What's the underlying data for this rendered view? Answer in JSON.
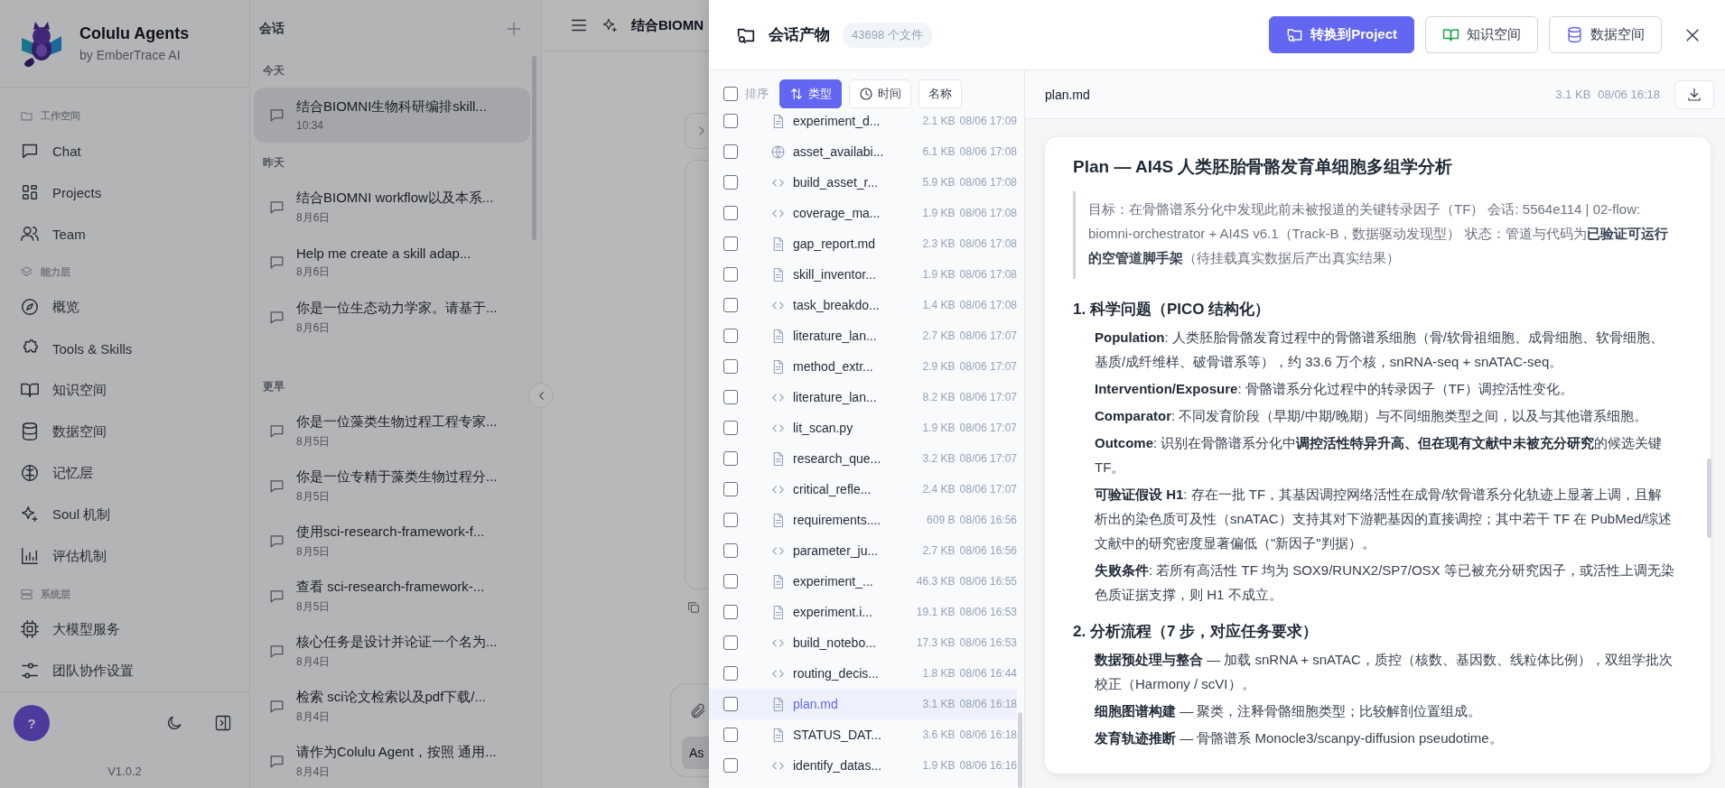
{
  "app": {
    "name": "Colulu Agents",
    "subtitle": "by EmberTrace AI",
    "help": "?",
    "version": "V1.0.2"
  },
  "sidebar": {
    "sections": [
      {
        "title": "工作空间",
        "kind": "folder",
        "items": [
          {
            "label": "Chat",
            "kind": "chat"
          },
          {
            "label": "Projects",
            "kind": "grid"
          },
          {
            "label": "Team",
            "kind": "team"
          }
        ]
      },
      {
        "title": "能力层",
        "kind": "layers",
        "items": [
          {
            "label": "概览",
            "kind": "compass"
          },
          {
            "label": "Tools & Skills",
            "kind": "puzzle"
          },
          {
            "label": "知识空间",
            "kind": "book"
          },
          {
            "label": "数据空间",
            "kind": "database"
          },
          {
            "label": "记忆层",
            "kind": "brain"
          },
          {
            "label": "Soul 机制",
            "kind": "sparkles"
          },
          {
            "label": "评估机制",
            "kind": "chart"
          }
        ]
      },
      {
        "title": "系统层",
        "kind": "server",
        "items": [
          {
            "label": "大模型服务",
            "kind": "cpu"
          },
          {
            "label": "团队协作设置",
            "kind": "sliders"
          }
        ]
      }
    ]
  },
  "conversations": {
    "title": "会话",
    "groups": [
      {
        "title": "今天",
        "items": [
          {
            "title": "结合BIOMNI生物科研编排skill...",
            "date": "10:34",
            "selected": true
          }
        ]
      },
      {
        "title": "昨天",
        "items": [
          {
            "title": "结合BIOMNI workflow以及本系...",
            "date": "8月6日",
            "selected": false
          },
          {
            "title": "Help me create a skill adap...",
            "date": "8月6日",
            "selected": false
          },
          {
            "title": "你是一位生态动力学家。请基于...",
            "date": "8月6日",
            "selected": false
          }
        ]
      },
      {
        "title": "更早",
        "items": [
          {
            "title": "你是一位藻类生物过程工程专家...",
            "date": "8月5日",
            "selected": false
          },
          {
            "title": "你是一位专精于藻类生物过程分...",
            "date": "8月5日",
            "selected": false
          },
          {
            "title": "使用sci-research-framework-f...",
            "date": "8月5日",
            "selected": false
          },
          {
            "title": "查看 sci-research-framework-...",
            "date": "8月5日",
            "selected": false
          },
          {
            "title": "核心任务是设计并论证一个名为...",
            "date": "8月4日",
            "selected": false
          },
          {
            "title": "检索 sci论文检索以及pdf下载/...",
            "date": "8月4日",
            "selected": false
          },
          {
            "title": "请作为Colulu Agent，按照 通用...",
            "date": "8月4日",
            "selected": false
          }
        ]
      }
    ]
  },
  "chat": {
    "title": "结合BIOMN",
    "input_button": "As"
  },
  "artifacts": {
    "title": "会话产物",
    "count": "43698 个文件",
    "actions": [
      {
        "label": "转换到Project",
        "kind": "primary"
      },
      {
        "label": "知识空间",
        "kind": "knowledge"
      },
      {
        "label": "数据空间",
        "kind": "data"
      }
    ],
    "select_all": {
      "checked": false
    },
    "sort_label": "排序",
    "sort_options": [
      {
        "label": "类型",
        "kind": "type",
        "selected": true
      },
      {
        "label": "时间",
        "kind": "time",
        "selected": false
      },
      {
        "label": "名称",
        "kind": "name",
        "selected": false
      }
    ],
    "files": [
      {
        "name": "experiment_d...",
        "size": "2.1 KB",
        "time": "08/06 17:09",
        "kind": "doc",
        "checked": false,
        "selected": false
      },
      {
        "name": "asset_availabi...",
        "size": "6.1 KB",
        "time": "08/06 17:08",
        "kind": "web",
        "checked": false,
        "selected": false
      },
      {
        "name": "build_asset_r...",
        "size": "5.9 KB",
        "time": "08/06 17:08",
        "kind": "code",
        "checked": false,
        "selected": false
      },
      {
        "name": "coverage_ma...",
        "size": "1.9 KB",
        "time": "08/06 17:08",
        "kind": "code",
        "checked": false,
        "selected": false
      },
      {
        "name": "gap_report.md",
        "size": "2.3 KB",
        "time": "08/06 17:08",
        "kind": "doc",
        "checked": false,
        "selected": false
      },
      {
        "name": "skill_inventor...",
        "size": "1.9 KB",
        "time": "08/06 17:08",
        "kind": "doc",
        "checked": false,
        "selected": false
      },
      {
        "name": "task_breakdo...",
        "size": "1.4 KB",
        "time": "08/06 17:08",
        "kind": "code",
        "checked": false,
        "selected": false
      },
      {
        "name": "literature_lan...",
        "size": "2.7 KB",
        "time": "08/06 17:07",
        "kind": "doc",
        "checked": false,
        "selected": false
      },
      {
        "name": "method_extr...",
        "size": "2.9 KB",
        "time": "08/06 17:07",
        "kind": "doc",
        "checked": false,
        "selected": false
      },
      {
        "name": "literature_lan...",
        "size": "8.2 KB",
        "time": "08/06 17:07",
        "kind": "code",
        "checked": false,
        "selected": false
      },
      {
        "name": "lit_scan.py",
        "size": "1.9 KB",
        "time": "08/06 17:07",
        "kind": "code",
        "checked": false,
        "selected": false
      },
      {
        "name": "research_que...",
        "size": "3.2 KB",
        "time": "08/06 17:07",
        "kind": "doc",
        "checked": false,
        "selected": false
      },
      {
        "name": "critical_refle...",
        "size": "2.4 KB",
        "time": "08/06 17:07",
        "kind": "code",
        "checked": false,
        "selected": false
      },
      {
        "name": "requirements....",
        "size": "609 B",
        "time": "08/06 16:56",
        "kind": "doc",
        "checked": false,
        "selected": false
      },
      {
        "name": "parameter_ju...",
        "size": "2.7 KB",
        "time": "08/06 16:56",
        "kind": "code",
        "checked": false,
        "selected": false
      },
      {
        "name": "experiment_...",
        "size": "46.3 KB",
        "time": "08/06 16:55",
        "kind": "doc",
        "checked": false,
        "selected": false
      },
      {
        "name": "experiment.i...",
        "size": "19.1 KB",
        "time": "08/06 16:53",
        "kind": "doc",
        "checked": false,
        "selected": false
      },
      {
        "name": "build_notebo...",
        "size": "17.3 KB",
        "time": "08/06 16:53",
        "kind": "code",
        "checked": false,
        "selected": false
      },
      {
        "name": "routing_decis...",
        "size": "1.8 KB",
        "time": "08/06 16:44",
        "kind": "code",
        "checked": false,
        "selected": false
      },
      {
        "name": "plan.md",
        "size": "3.1 KB",
        "time": "08/06 16:18",
        "kind": "doc",
        "checked": false,
        "selected": true
      },
      {
        "name": "STATUS_DAT...",
        "size": "3.6 KB",
        "time": "08/06 16:18",
        "kind": "doc",
        "checked": false,
        "selected": false
      },
      {
        "name": "identify_datas...",
        "size": "1.9 KB",
        "time": "08/06 16:16",
        "kind": "code",
        "checked": false,
        "selected": false
      }
    ]
  },
  "preview": {
    "file_name": "plan.md",
    "size": "3.1 KB",
    "time": "08/06 16:18",
    "title": "Plan — AI4S 人类胚胎骨骼发育单细胞多组学分析",
    "blocks": [
      {
        "kind": "quote",
        "text": "目标：在骨骼谱系分化中发现此前未被报道的关键转录因子（TF） 会话: 5564e114 | 02-flow: biomni-orchestrator + AI4S v6.1（Track-B，数据驱动发现型） 状态：管道与代码为**已验证可运行的空管道脚手架**（待挂载真实数据后产出真实结果）"
      },
      {
        "kind": "heading",
        "text": "1. 科学问题（PICO 结构化）"
      },
      {
        "kind": "item",
        "text": "**Population**: 人类胚胎骨骼发育过程中的骨骼谱系细胞（骨/软骨祖细胞、成骨细胞、软骨细胞、基质/成纤维样、破骨谱系等），约 33.6 万个核，snRNA-seq + snATAC-seq。"
      },
      {
        "kind": "item",
        "text": "**Intervention/Exposure**: 骨骼谱系分化过程中的转录因子（TF）调控活性变化。"
      },
      {
        "kind": "item",
        "text": "**Comparator**: 不同发育阶段（早期/中期/晚期）与不同细胞类型之间，以及与其他谱系细胞。"
      },
      {
        "kind": "item",
        "text": "**Outcome**: 识别在骨骼谱系分化中**调控活性特异升高、但在现有文献中未被充分研究**的候选关键 TF。"
      },
      {
        "kind": "item",
        "text": "**可验证假设 H1**: 存在一批 TF，其基因调控网络活性在成骨/软骨谱系分化轨迹上显著上调，且解析出的染色质可及性（snATAC）支持其对下游靶基因的直接调控；其中若干 TF 在 PubMed/综述文献中的研究密度显著偏低（\"新因子\"判据）。"
      },
      {
        "kind": "item",
        "text": "**失败条件**: 若所有高活性 TF 均为 SOX9/RUNX2/SP7/OSX 等已被充分研究因子，或活性上调无染色质证据支撑，则 H1 不成立。"
      },
      {
        "kind": "heading",
        "text": "2. 分析流程（7 步，对应任务要求）"
      },
      {
        "kind": "item",
        "text": "**数据预处理与整合** — 加载 snRNA + snATAC，质控（核数、基因数、线粒体比例），双组学批次校正（Harmony / scVI）。"
      },
      {
        "kind": "item",
        "text": "**细胞图谱构建** — 聚类，注释骨骼细胞类型；比较解剖位置组成。"
      },
      {
        "kind": "item",
        "text": "**发育轨迹推断** — 骨骼谱系 Monocle3/scanpy-diffusion pseudotime。"
      }
    ]
  }
}
